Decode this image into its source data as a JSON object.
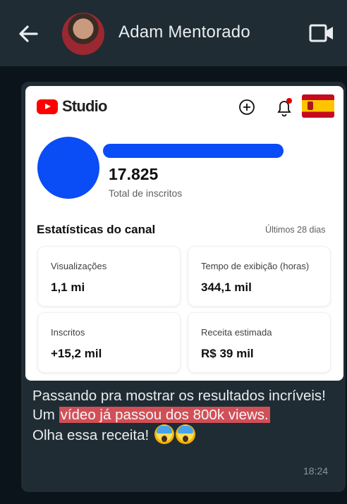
{
  "header": {
    "contact_name": "Adam Mentorado"
  },
  "studio": {
    "brand": "Studio",
    "subscriber_count": "17.825",
    "subscriber_label": "Total de inscritos",
    "stats_title": "Estatísticas do canal",
    "stats_period": "Últimos 28 dias",
    "stats": [
      {
        "label": "Visualizações",
        "value": "1,1 mi"
      },
      {
        "label": "Tempo de exibição (horas)",
        "value": "344,1 mil"
      },
      {
        "label": "Inscritos",
        "value": "+15,2 mil"
      },
      {
        "label": "Receita estimada",
        "value": "R$ 39 mil"
      }
    ]
  },
  "message": {
    "line1": "Passando pra mostrar os resultados incríveis!",
    "line2_prefix": "Um ",
    "line2_highlight": "vídeo já passou dos 800k views.",
    "line3": "Olha essa receita!",
    "time": "18:24"
  },
  "colors": {
    "header_bg": "#1f2c34",
    "chat_bg": "#0b141a",
    "bubble_bg": "#1f2c34",
    "highlight": "#d14f57",
    "redaction_blue": "#0a4cf5"
  }
}
